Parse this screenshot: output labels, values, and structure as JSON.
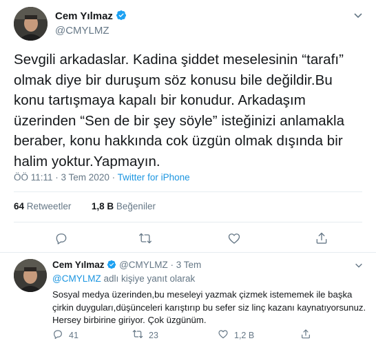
{
  "main_tweet": {
    "author_name": "Cem Yılmaz",
    "author_handle": "@CMYLMZ",
    "text": "Sevgili arkadaslar. Kadina şiddet meselesinin “tarafı” olmak diye bir duruşum söz konusu bile değildir.Bu konu tartışmaya kapalı bir konudur. Arkadaşım üzerinden “Sen de bir şey söyle” isteğinizi anlamakla beraber, konu hakkında cok üzgün olmak dışında bir halim yoktur.Yapmayın.",
    "time": "ÖÖ 11:11 · 3 Tem 2020 · ",
    "source": "Twitter for iPhone",
    "retweets_count": "64",
    "retweets_label": "Retweetler",
    "likes_count": "1,8 B",
    "likes_label": "Beğeniler"
  },
  "reply_tweet": {
    "author_name": "Cem Yılmaz",
    "author_handle": "@CMYLMZ · 3 Tem",
    "reply_to_mention": "@CMYLMZ",
    "reply_to_suffix": " adlı kişiye yanıt olarak",
    "text": "Sosyal medya üzerinden,bu meseleyi yazmak çizmek istememek ile başka çirkin duyguları,düşünceleri karıştırıp bu sefer siz linç kazanı kaynatıyorsunuz. Hersey birbirine giriyor. Çok üzgünüm.",
    "reply_count": "41",
    "retweet_count": "23",
    "like_count": "1,2 B"
  },
  "colors": {
    "accent": "#1b95e0",
    "muted": "#657786",
    "divider": "#e6ecf0"
  },
  "icons": [
    "verified-icon",
    "chevron-down-icon",
    "reply-icon",
    "retweet-icon",
    "like-icon",
    "share-icon"
  ]
}
